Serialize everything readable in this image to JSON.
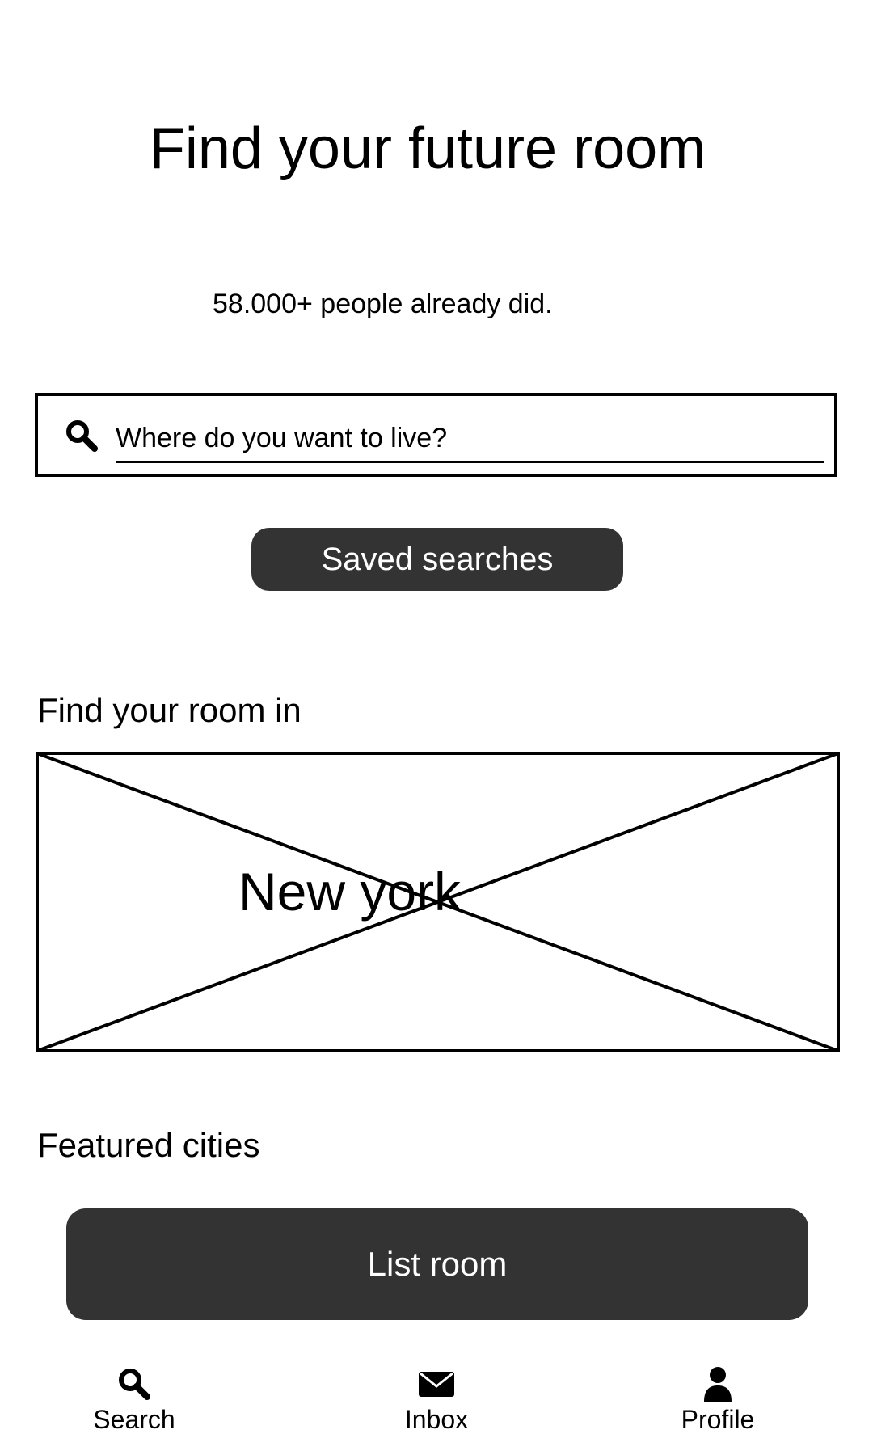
{
  "header": {
    "title": "Find your future room",
    "subtitle": "58.000+ people already did."
  },
  "search": {
    "placeholder": "Where do you want to live?",
    "icon": "search-icon"
  },
  "saved_searches": {
    "label": "Saved searches"
  },
  "city_section": {
    "heading": "Find your room in",
    "city": "New york"
  },
  "featured": {
    "heading": "Featured cities"
  },
  "list_room": {
    "label": "List room"
  },
  "bottom_nav": {
    "items": [
      {
        "label": "Search",
        "icon": "search-icon"
      },
      {
        "label": "Inbox",
        "icon": "envelope-icon"
      },
      {
        "label": "Profile",
        "icon": "user-icon"
      }
    ]
  },
  "colors": {
    "button_bg": "#333333",
    "button_text": "#ffffff",
    "text": "#000000",
    "background": "#ffffff"
  }
}
